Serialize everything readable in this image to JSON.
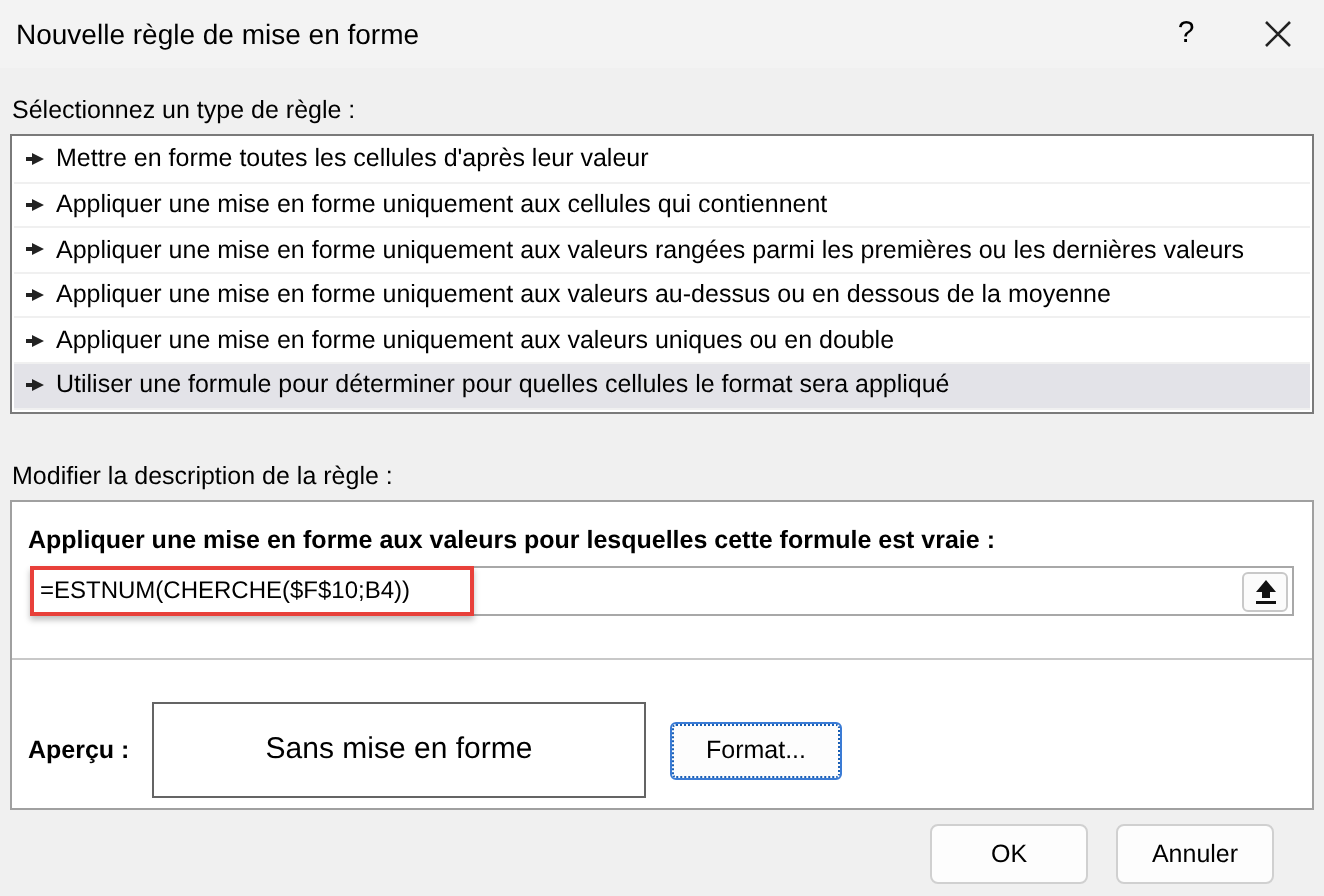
{
  "window": {
    "title": "Nouvelle règle de mise en forme",
    "help": "?"
  },
  "rule_types": {
    "label": "Sélectionnez un type de règle :",
    "items": [
      {
        "label": "Mettre en forme toutes les cellules d'après leur valeur",
        "selected": false
      },
      {
        "label": "Appliquer une mise en forme uniquement aux cellules qui contiennent",
        "selected": false
      },
      {
        "label": "Appliquer une mise en forme uniquement aux valeurs rangées parmi les premières ou les dernières valeurs",
        "selected": false
      },
      {
        "label": "Appliquer une mise en forme uniquement aux valeurs au-dessus ou en dessous de la moyenne",
        "selected": false
      },
      {
        "label": "Appliquer une mise en forme uniquement aux valeurs uniques ou en double",
        "selected": false
      },
      {
        "label": "Utiliser une formule pour déterminer pour quelles cellules le format sera appliqué",
        "selected": true
      }
    ]
  },
  "description": {
    "label": "Modifier la description de la règle :",
    "formula_label": "Appliquer une mise en forme aux valeurs pour lesquelles cette formule est vraie :",
    "formula": {
      "value": "=ESTNUM(CHERCHE($F$10;B4))",
      "highlighted": true
    },
    "preview_label": "Aperçu :",
    "preview": "Sans mise en forme",
    "format_button": "Format..."
  },
  "buttons": [
    {
      "label": "OK"
    },
    {
      "label": "Annuler"
    }
  ]
}
